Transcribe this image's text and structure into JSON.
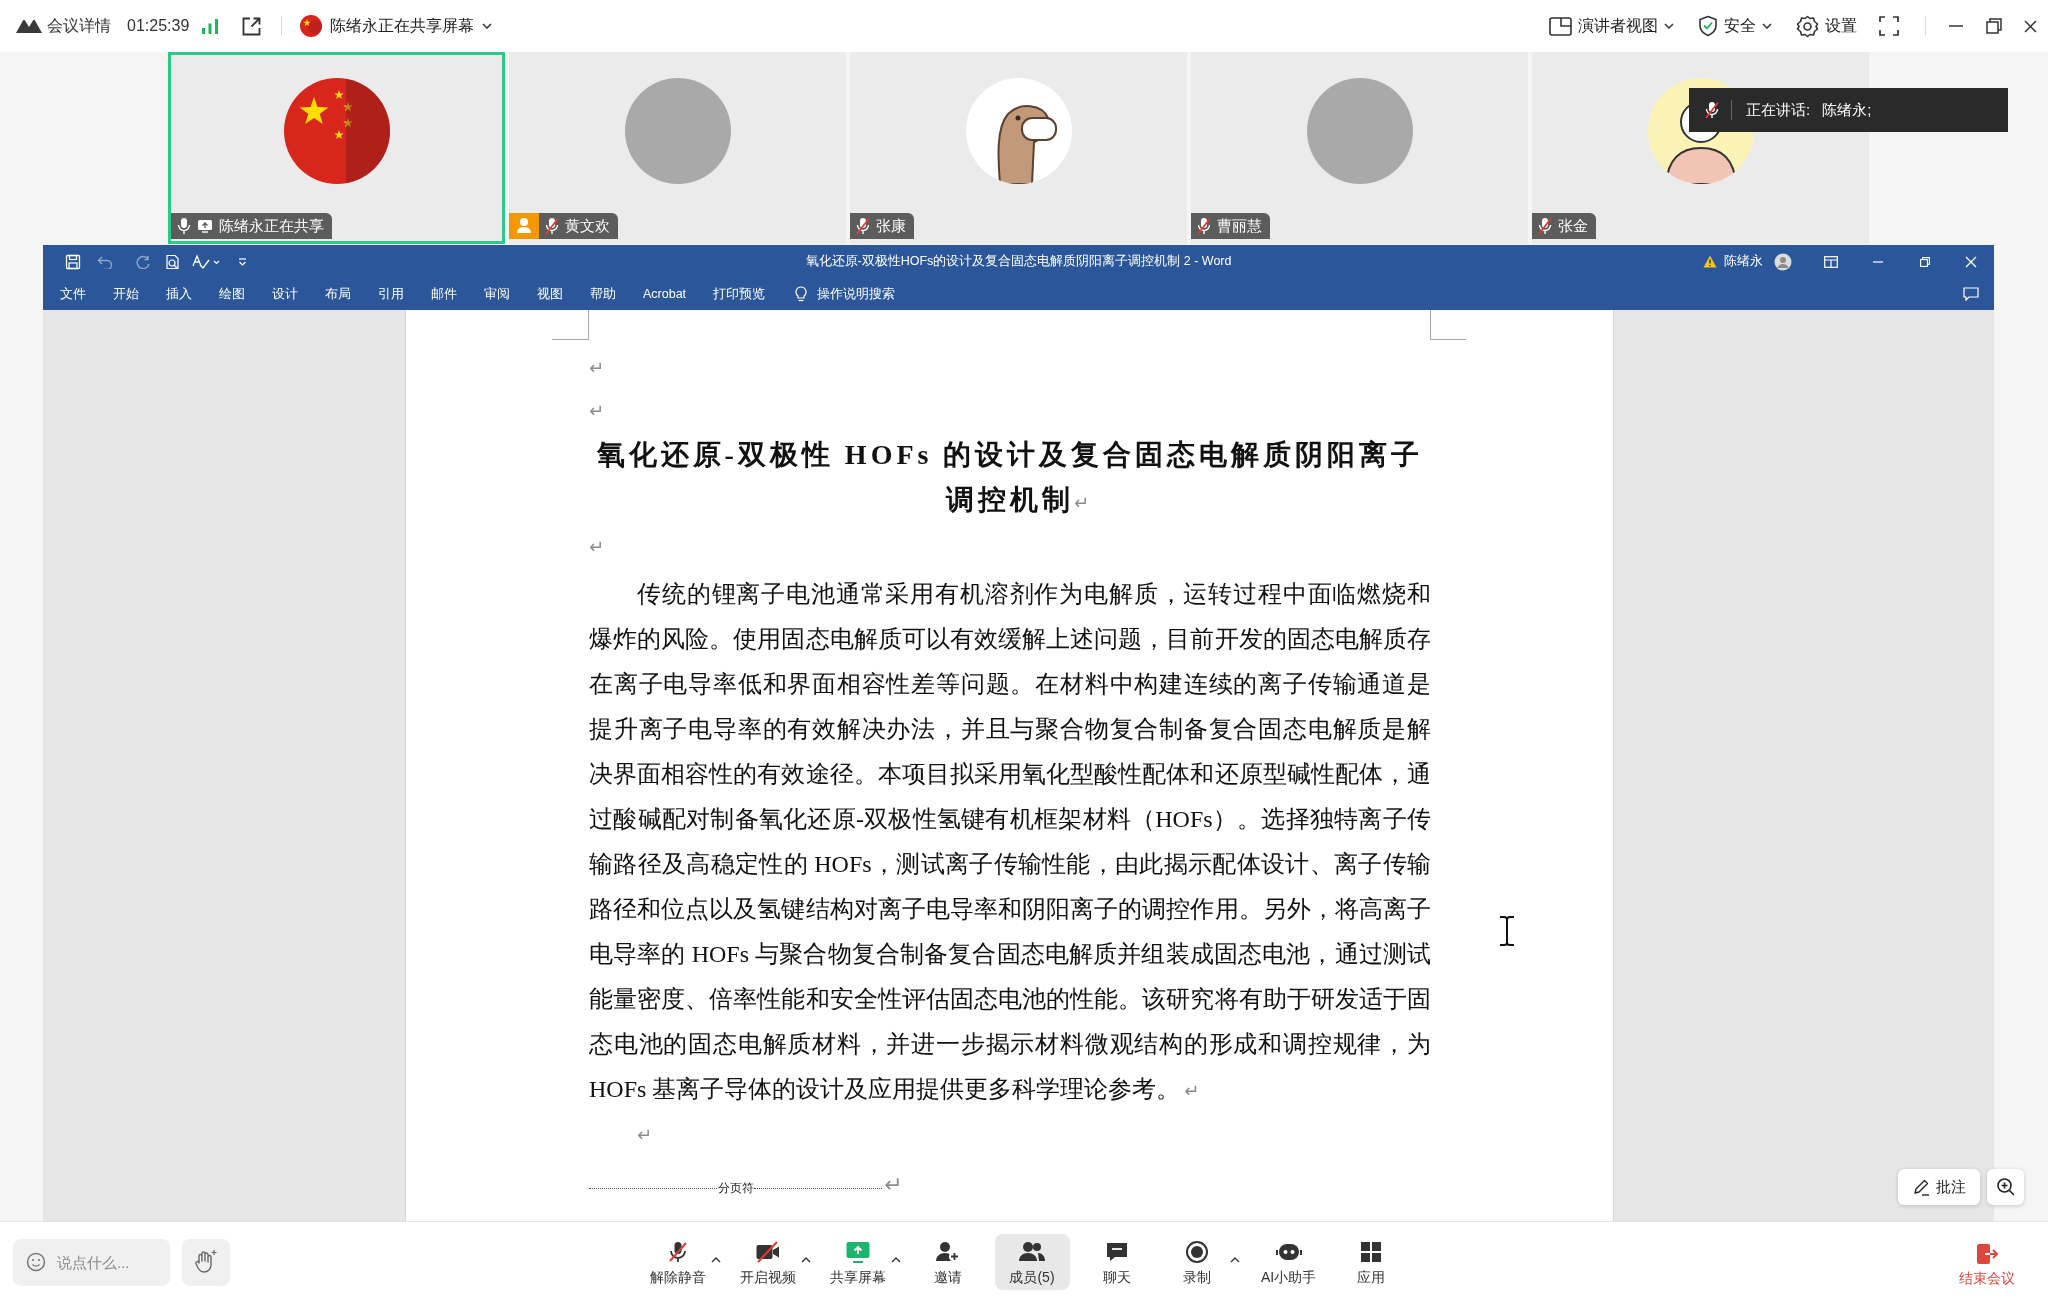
{
  "top_bar": {
    "meeting_info": "会议详情",
    "timer": "01:25:39",
    "sharer": "陈绪永正在共享屏幕",
    "actions": [
      {
        "kind": "presenter",
        "label": "演讲者视图",
        "dropdown": true
      },
      {
        "kind": "security",
        "label": "安全",
        "dropdown": true
      },
      {
        "kind": "settings",
        "label": "设置",
        "dropdown": false
      }
    ]
  },
  "participants": [
    {
      "name": "陈绪永正在共享",
      "avatar": {
        "kind": "flag"
      },
      "speaking": true,
      "muted": false,
      "sharing": true,
      "person_badge": false
    },
    {
      "name": "黄文欢",
      "avatar": {
        "kind": "photo"
      },
      "speaking": false,
      "muted": true,
      "sharing": false,
      "person_badge": true
    },
    {
      "name": "张康",
      "avatar": {
        "kind": "dinosaur"
      },
      "speaking": false,
      "muted": true,
      "sharing": false,
      "person_badge": false
    },
    {
      "name": "曹丽慧",
      "avatar": {
        "kind": "photo"
      },
      "speaking": false,
      "muted": true,
      "sharing": false,
      "person_badge": false
    },
    {
      "name": "张金",
      "avatar": {
        "kind": "portrait"
      },
      "speaking": false,
      "muted": true,
      "sharing": false,
      "person_badge": false
    }
  ],
  "speaking_tooltip": {
    "label": "正在讲话:",
    "names": "陈绪永;"
  },
  "word": {
    "title": "氧化还原-双极性HOFs的设计及复合固态电解质阴阳离子调控机制 2 - Word",
    "user": "陈绪永",
    "tabs": [
      "文件",
      "开始",
      "插入",
      "绘图",
      "设计",
      "布局",
      "引用",
      "邮件",
      "审阅",
      "视图",
      "帮助",
      "Acrobat",
      "打印预览"
    ],
    "search": {
      "placeholder": "操作说明搜索"
    }
  },
  "document": {
    "blocks": [
      {
        "kind": "empty",
        "mark": "↵"
      },
      {
        "kind": "empty",
        "mark": "↵"
      },
      {
        "kind": "title",
        "lines": [
          "氧化还原-双极性 HOFs 的设计及复合固态电解质阴阳离子",
          "调控机制"
        ],
        "mark": "↵"
      },
      {
        "kind": "empty",
        "mark": "↵"
      },
      {
        "kind": "body",
        "lines": [
          "传统的锂离子电池通常采用有机溶剂作为电解质，运转过程中面临燃烧和",
          "爆炸的风险。使用固态电解质可以有效缓解上述问题，目前开发的固态电解质存",
          "在离子电导率低和界面相容性差等问题。在材料中构建连续的离子传输通道是",
          "提升离子电导率的有效解决办法，并且与聚合物复合制备复合固态电解质是解",
          "决界面相容性的有效途径。本项目拟采用氧化型酸性配体和还原型碱性配体，通",
          "过酸碱配对制备氧化还原-双极性氢键有机框架材料（HOFs）。选择独特离子传",
          "输路径及高稳定性的 HOFs，测试离子传输性能，由此揭示配体设计、离子传输",
          "路径和位点以及氢键结构对离子电导率和阴阳离子的调控作用。另外，将高离子",
          "电导率的 HOFs 与聚合物复合制备复合固态电解质并组装成固态电池，通过测试",
          "能量密度、倍率性能和安全性评估固态电池的性能。该研究将有助于研发适于固",
          "态电池的固态电解质材料，并进一步揭示材料微观结构的形成和调控规律，为",
          "HOFs 基离子导体的设计及应用提供更多科学理论参考。"
        ],
        "mark": "↵"
      },
      {
        "kind": "indented",
        "mark": "↵"
      },
      {
        "kind": "page_break",
        "label": "分页符",
        "mark": "↵"
      }
    ]
  },
  "float_buttons": {
    "annotate": "批注"
  },
  "toolbar": {
    "chat_field": {
      "placeholder": "说点什么..."
    },
    "items": [
      {
        "kind": "mic",
        "label": "解除静音",
        "menu": true,
        "selected": false
      },
      {
        "kind": "camera",
        "label": "开启视频",
        "menu": true,
        "selected": false
      },
      {
        "kind": "share",
        "label": "共享屏幕",
        "menu": true,
        "selected": false
      },
      {
        "kind": "invite",
        "label": "邀请",
        "menu": false,
        "selected": false
      },
      {
        "kind": "members",
        "label": "成员(5)",
        "menu": false,
        "selected": true
      },
      {
        "kind": "chat",
        "label": "聊天",
        "menu": false,
        "selected": false
      },
      {
        "kind": "record",
        "label": "录制",
        "menu": true,
        "selected": false
      },
      {
        "kind": "assistant",
        "label": "AI小助手",
        "menu": false,
        "selected": false
      },
      {
        "kind": "apps",
        "label": "应用",
        "menu": false,
        "selected": false
      }
    ],
    "end_label": "结束会议"
  }
}
